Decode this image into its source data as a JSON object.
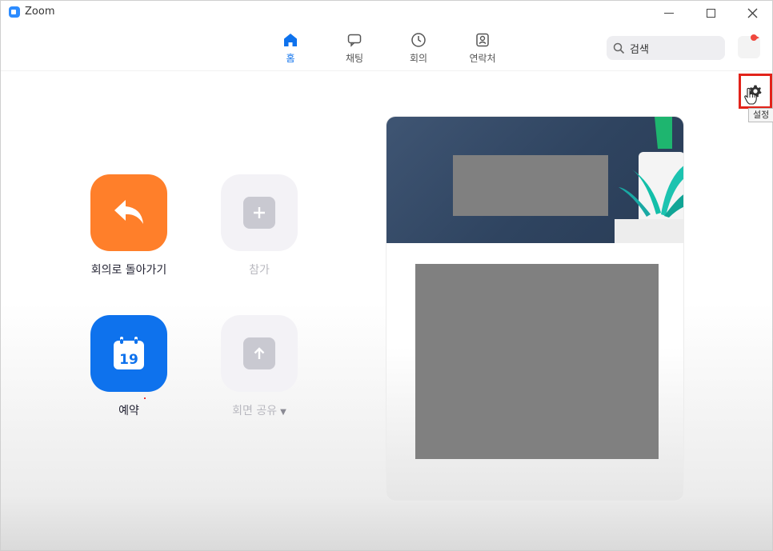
{
  "window": {
    "title": "Zoom"
  },
  "nav": {
    "items": [
      {
        "label": "홈",
        "icon": "home-icon",
        "active": true
      },
      {
        "label": "채팅",
        "icon": "chat-icon",
        "active": false
      },
      {
        "label": "회의",
        "icon": "clock-icon",
        "active": false
      },
      {
        "label": "연락처",
        "icon": "contacts-icon",
        "active": false
      }
    ]
  },
  "search": {
    "value": "검색"
  },
  "settings": {
    "tooltip": "설정"
  },
  "actions": {
    "back_to_meeting": "회의로 돌아가기",
    "join": "참가",
    "schedule": "예약",
    "schedule_date": "19",
    "share_screen": "회면 공유"
  },
  "colors": {
    "accent": "#0e72ed",
    "orange": "#ff7f2a",
    "highlight": "#e2231a"
  }
}
